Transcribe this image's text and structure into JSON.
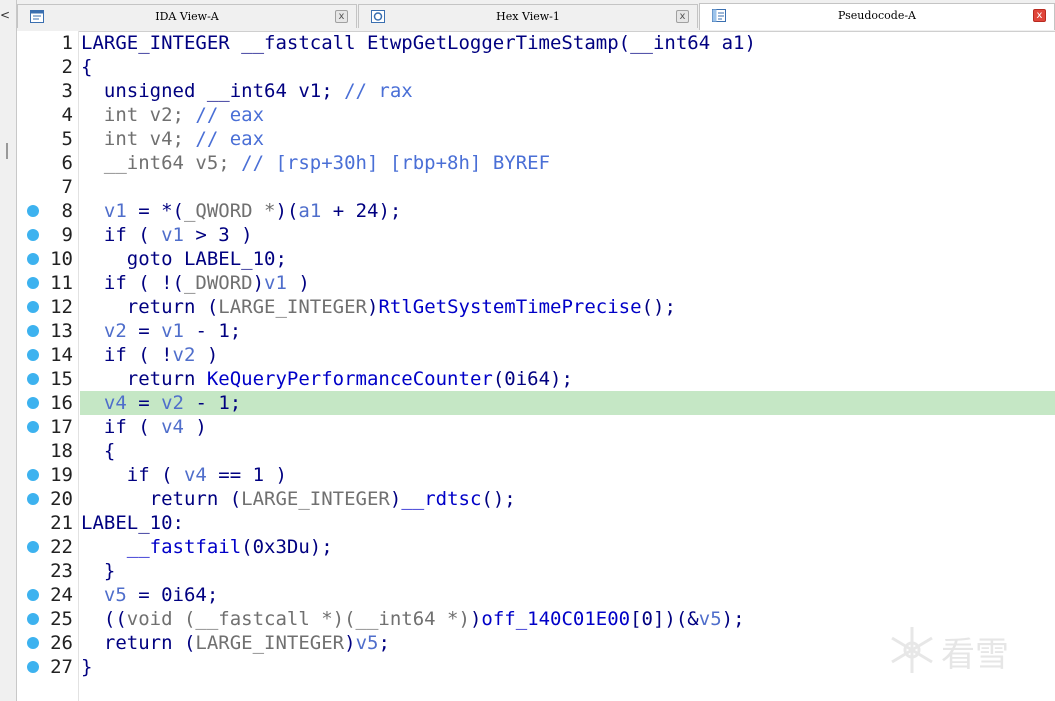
{
  "left_panel": {
    "close_glyph": "<"
  },
  "tabs": [
    {
      "label": "IDA View-A",
      "icon": "ida-view-icon",
      "active": false,
      "close": "x"
    },
    {
      "label": "Hex View-1",
      "icon": "hex-view-icon",
      "active": false,
      "close": "x"
    },
    {
      "label": "Pseudocode-A",
      "icon": "pseudocode-icon",
      "active": true,
      "close": "x"
    }
  ],
  "highlighted_line": 16,
  "lines": [
    {
      "n": "1",
      "bp": false,
      "segs": [
        [
          "n",
          "LARGE_INTEGER __fastcall EtwpGetLoggerTimeStamp(__int64 a1)"
        ]
      ]
    },
    {
      "n": "2",
      "bp": false,
      "segs": [
        [
          "n",
          "{"
        ]
      ]
    },
    {
      "n": "3",
      "bp": false,
      "segs": [
        [
          "n",
          "  unsigned __int64 v1; "
        ],
        [
          "cm",
          "// rax"
        ]
      ]
    },
    {
      "n": "4",
      "bp": false,
      "segs": [
        [
          "gr",
          "  int v2; "
        ],
        [
          "cm",
          "// eax"
        ]
      ]
    },
    {
      "n": "5",
      "bp": false,
      "segs": [
        [
          "gr",
          "  int v4; "
        ],
        [
          "cm",
          "// eax"
        ]
      ]
    },
    {
      "n": "6",
      "bp": false,
      "segs": [
        [
          "gr",
          "  __int64 v5; "
        ],
        [
          "cm",
          "// [rsp+30h] [rbp+8h] BYREF"
        ]
      ]
    },
    {
      "n": "7",
      "bp": false,
      "segs": [
        [
          "n",
          ""
        ]
      ]
    },
    {
      "n": "8",
      "bp": true,
      "segs": [
        [
          "n",
          "  "
        ],
        [
          "v",
          "v1"
        ],
        [
          "n",
          " = *("
        ],
        [
          "gr",
          "_QWORD *"
        ],
        [
          "n",
          ")("
        ],
        [
          "v",
          "a1"
        ],
        [
          "n",
          " + 24);"
        ]
      ]
    },
    {
      "n": "9",
      "bp": true,
      "segs": [
        [
          "n",
          "  if ( "
        ],
        [
          "v",
          "v1"
        ],
        [
          "n",
          " > 3 )"
        ]
      ]
    },
    {
      "n": "10",
      "bp": true,
      "segs": [
        [
          "n",
          "    goto LABEL_10;"
        ]
      ]
    },
    {
      "n": "11",
      "bp": true,
      "segs": [
        [
          "n",
          "  if ( !("
        ],
        [
          "gr",
          "_DWORD"
        ],
        [
          "n",
          ")"
        ],
        [
          "v",
          "v1"
        ],
        [
          "n",
          " )"
        ]
      ]
    },
    {
      "n": "12",
      "bp": true,
      "segs": [
        [
          "n",
          "    return ("
        ],
        [
          "gr",
          "LARGE_INTEGER"
        ],
        [
          "n",
          ")"
        ],
        [
          "fn",
          "RtlGetSystemTimePrecise"
        ],
        [
          "n",
          "();"
        ]
      ]
    },
    {
      "n": "13",
      "bp": true,
      "segs": [
        [
          "n",
          "  "
        ],
        [
          "v",
          "v2"
        ],
        [
          "n",
          " = "
        ],
        [
          "v",
          "v1"
        ],
        [
          "n",
          " - 1;"
        ]
      ]
    },
    {
      "n": "14",
      "bp": true,
      "segs": [
        [
          "n",
          "  if ( !"
        ],
        [
          "v",
          "v2"
        ],
        [
          "n",
          " )"
        ]
      ]
    },
    {
      "n": "15",
      "bp": true,
      "segs": [
        [
          "n",
          "    return "
        ],
        [
          "fn",
          "KeQueryPerformanceCounter"
        ],
        [
          "n",
          "(0i64);"
        ]
      ]
    },
    {
      "n": "16",
      "bp": true,
      "segs": [
        [
          "n",
          "  "
        ],
        [
          "v",
          "v4"
        ],
        [
          "n",
          " = "
        ],
        [
          "v",
          "v2"
        ],
        [
          "n",
          " - 1;"
        ]
      ]
    },
    {
      "n": "17",
      "bp": true,
      "segs": [
        [
          "n",
          "  if ( "
        ],
        [
          "v",
          "v4"
        ],
        [
          "n",
          " )"
        ]
      ]
    },
    {
      "n": "18",
      "bp": false,
      "segs": [
        [
          "n",
          "  {"
        ]
      ]
    },
    {
      "n": "19",
      "bp": true,
      "segs": [
        [
          "n",
          "    if ( "
        ],
        [
          "v",
          "v4"
        ],
        [
          "n",
          " == 1 )"
        ]
      ]
    },
    {
      "n": "20",
      "bp": true,
      "segs": [
        [
          "n",
          "      return ("
        ],
        [
          "gr",
          "LARGE_INTEGER"
        ],
        [
          "n",
          ")"
        ],
        [
          "fn",
          "__rdtsc"
        ],
        [
          "n",
          "();"
        ]
      ]
    },
    {
      "n": "21",
      "bp": false,
      "segs": [
        [
          "n",
          "LABEL_10:"
        ]
      ]
    },
    {
      "n": "22",
      "bp": true,
      "segs": [
        [
          "n",
          "    "
        ],
        [
          "fn",
          "__fastfail"
        ],
        [
          "n",
          "(0x3Du);"
        ]
      ]
    },
    {
      "n": "23",
      "bp": false,
      "segs": [
        [
          "n",
          "  }"
        ]
      ]
    },
    {
      "n": "24",
      "bp": true,
      "segs": [
        [
          "n",
          "  "
        ],
        [
          "v",
          "v5"
        ],
        [
          "n",
          " = 0i64;"
        ]
      ]
    },
    {
      "n": "25",
      "bp": true,
      "segs": [
        [
          "n",
          "  (("
        ],
        [
          "gr",
          "void (__fastcall *)(__int64 *)"
        ],
        [
          "n",
          ")"
        ],
        [
          "fn",
          "off_140C01E00"
        ],
        [
          "n",
          "[0])(&"
        ],
        [
          "v",
          "v5"
        ],
        [
          "n",
          ");"
        ]
      ]
    },
    {
      "n": "26",
      "bp": true,
      "segs": [
        [
          "n",
          "  return ("
        ],
        [
          "gr",
          "LARGE_INTEGER"
        ],
        [
          "n",
          ")"
        ],
        [
          "v",
          "v5"
        ],
        [
          "n",
          ";"
        ]
      ]
    },
    {
      "n": "27",
      "bp": true,
      "segs": [
        [
          "n",
          "}"
        ]
      ]
    }
  ],
  "colors": {
    "breakpoint_dot": "#3db2ef",
    "highlight": "#c5e7c5",
    "code_default": "#000080",
    "variable": "#4f6ecb",
    "comment": "#4a6fd6",
    "type_gray": "#707070",
    "function": "#0000c8",
    "active_tab_close": "#e0453a"
  },
  "watermark": {
    "text": "看雪",
    "icon": "snowflake-icon"
  }
}
